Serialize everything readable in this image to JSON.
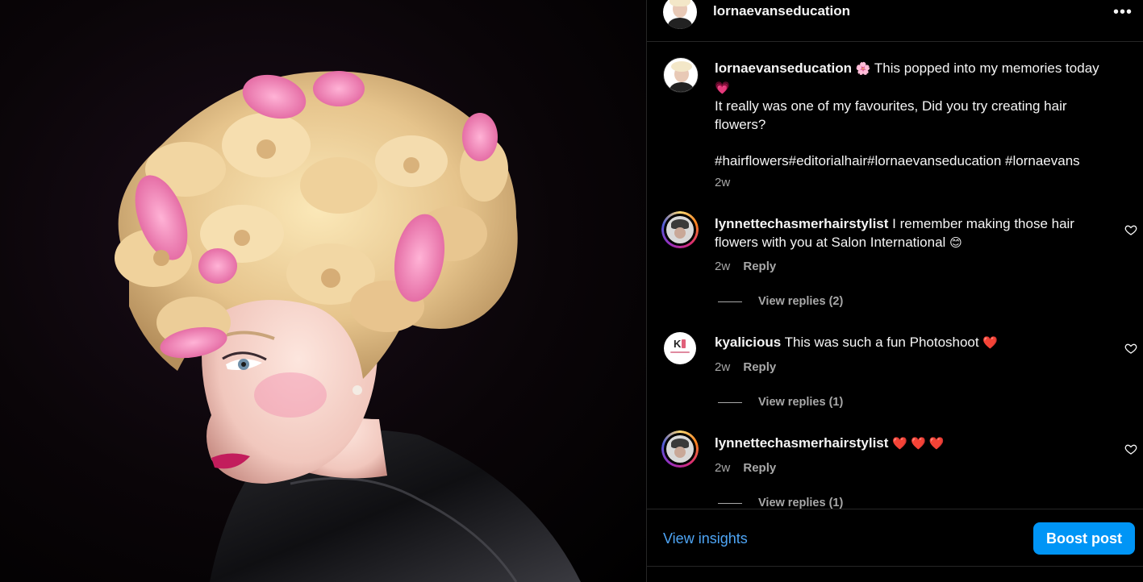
{
  "post": {
    "author": "lornaevanseducation",
    "caption_emoji_1": "🌸",
    "caption_line1": "This popped into my memories today",
    "caption_emoji_2": "💗",
    "caption_line2": "It really was one of my favourites, Did you try creating hair",
    "caption_line3": "flowers?",
    "hashtags": "#hairflowers#editorialhair#lornaevanseducation #lornaevans",
    "time": "2w",
    "more_icon": "more-horizontal-icon"
  },
  "comments": [
    {
      "user": "lynnettechasmerhairstylist",
      "text_line1": "I remember making those hair",
      "text_line2": "flowers with you at Salon International",
      "emoji": "😊",
      "time": "2w",
      "reply_label": "Reply",
      "view_replies": "View replies (2)"
    },
    {
      "user": "kyalicious",
      "text_line1": "This was such a fun Photoshoot",
      "emoji": "❤️",
      "time": "2w",
      "reply_label": "Reply",
      "view_replies": "View replies (1)"
    },
    {
      "user": "lynnettechasmerhairstylist",
      "emoji": "❤️ ❤️ ❤️",
      "time": "2w",
      "reply_label": "Reply",
      "view_replies": "View replies (1)"
    }
  ],
  "footer": {
    "insights_label": "View insights",
    "boost_label": "Boost post"
  },
  "colors": {
    "accent": "#0095f6",
    "link": "#4ea5f5",
    "muted": "#a8a8a8",
    "divider": "#262626"
  }
}
